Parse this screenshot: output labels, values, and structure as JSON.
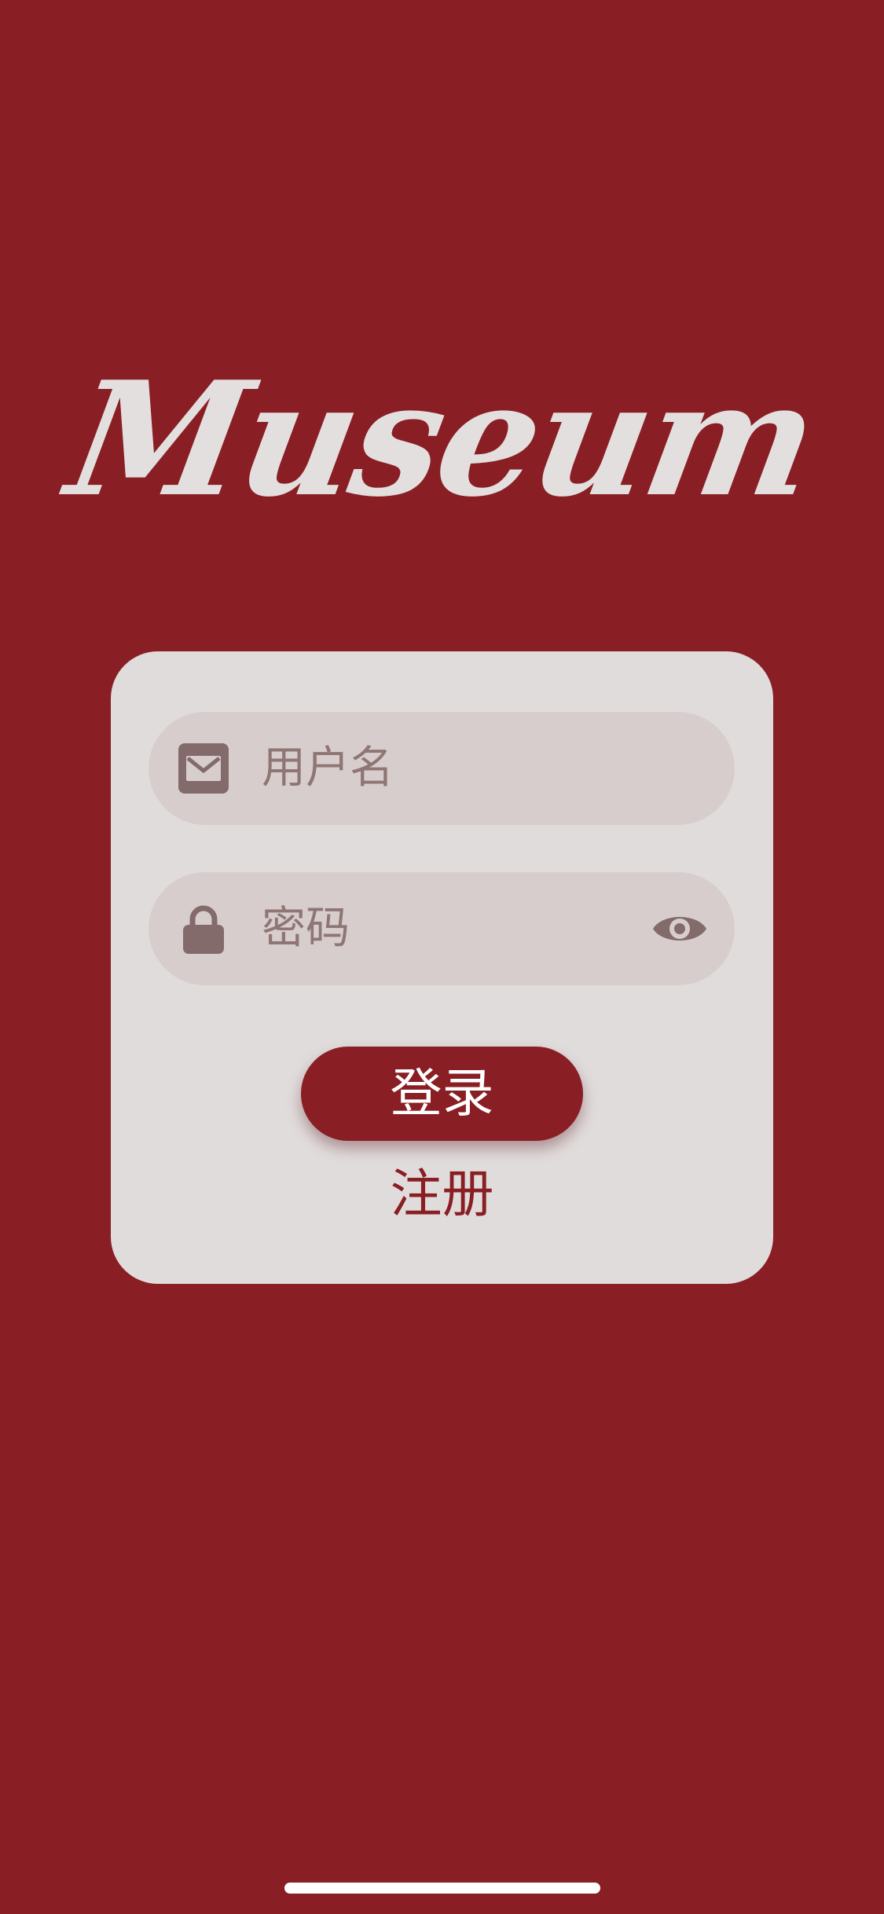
{
  "app": {
    "logo_text": "Museum"
  },
  "login_form": {
    "username": {
      "placeholder": "用户名",
      "icon": "envelope-icon"
    },
    "password": {
      "placeholder": "密码",
      "icon": "lock-icon",
      "toggle_icon": "eye-icon"
    },
    "login_button_label": "登录",
    "register_link_label": "注册"
  },
  "colors": {
    "background": "#891f24",
    "card": "#e1dcdc",
    "field": "#d8cdcd",
    "placeholder_text": "#8e7675",
    "icon": "#836a6b",
    "logo": "#e4dfdf",
    "button": "#891f24",
    "button_text": "#ffffff",
    "register_text": "#891f24"
  }
}
